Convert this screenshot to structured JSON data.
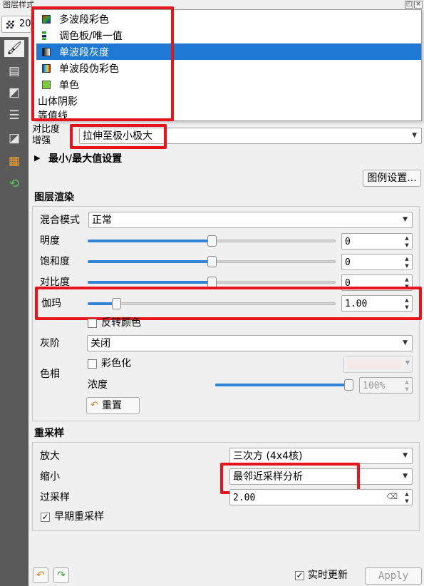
{
  "window": {
    "title": "图层样式"
  },
  "layer_selector": {
    "value": "20"
  },
  "render_type_dropdown": {
    "items": [
      {
        "label": "多波段彩色",
        "icon": "multiband-color-icon"
      },
      {
        "label": "调色板/唯一值",
        "icon": "palette-icon"
      },
      {
        "label": "单波段灰度",
        "icon": "singleband-gray-icon",
        "selected": true
      },
      {
        "label": "单波段伪彩色",
        "icon": "singleband-pseudocolor-icon"
      },
      {
        "label": "单色",
        "icon": "single-color-icon"
      },
      {
        "label": "山体阴影",
        "icon": ""
      },
      {
        "label": "等值线",
        "icon": ""
      }
    ]
  },
  "contrast": {
    "label_line1": "对比度",
    "label_line2": "增强",
    "value": "拉伸至极小极大"
  },
  "minmax": {
    "label": "最小/最大值设置"
  },
  "legend_button": {
    "label": "图例设置..."
  },
  "layer_rendering": {
    "heading": "图层渲染",
    "blend_mode": {
      "label": "混合模式",
      "value": "正常"
    },
    "brightness": {
      "label": "明度",
      "value": "0"
    },
    "saturation": {
      "label": "饱和度",
      "value": "0"
    },
    "contrast": {
      "label": "对比度",
      "value": "0"
    },
    "gamma": {
      "label": "伽玛",
      "value": "1.00"
    },
    "invert": {
      "label": "反转颜色",
      "checked": false
    },
    "grayscale": {
      "label": "灰阶",
      "value": "关闭"
    },
    "hue": {
      "label": "色相",
      "colorize_label": "彩色化",
      "colorize_checked": false,
      "strength_label": "浓度",
      "strength_value": "100%"
    },
    "reset_button": {
      "label": "重置"
    }
  },
  "resampling": {
    "heading": "重采样",
    "zoomed_in": {
      "label": "放大",
      "value": "三次方 (4x4核)"
    },
    "zoomed_out": {
      "label": "缩小",
      "value": "最邻近采样分析"
    },
    "oversampling": {
      "label": "过采样",
      "value": "2.00"
    },
    "early_resampling": {
      "label": "早期重采样",
      "checked": true
    }
  },
  "bottom_bar": {
    "live_update_label": "实时更新",
    "live_update_checked": true,
    "apply_label": "Apply"
  },
  "colors": {
    "highlight_red": "#e8141c",
    "selection_blue": "#1e78d4",
    "slider_blue": "#2f83d8",
    "toolbar_gray": "#5a5a5a"
  },
  "slider_levels": {
    "brightness": 0.5,
    "saturation": 0.5,
    "contrast": 0.5,
    "gamma": 0.1,
    "strength": 1.0
  }
}
